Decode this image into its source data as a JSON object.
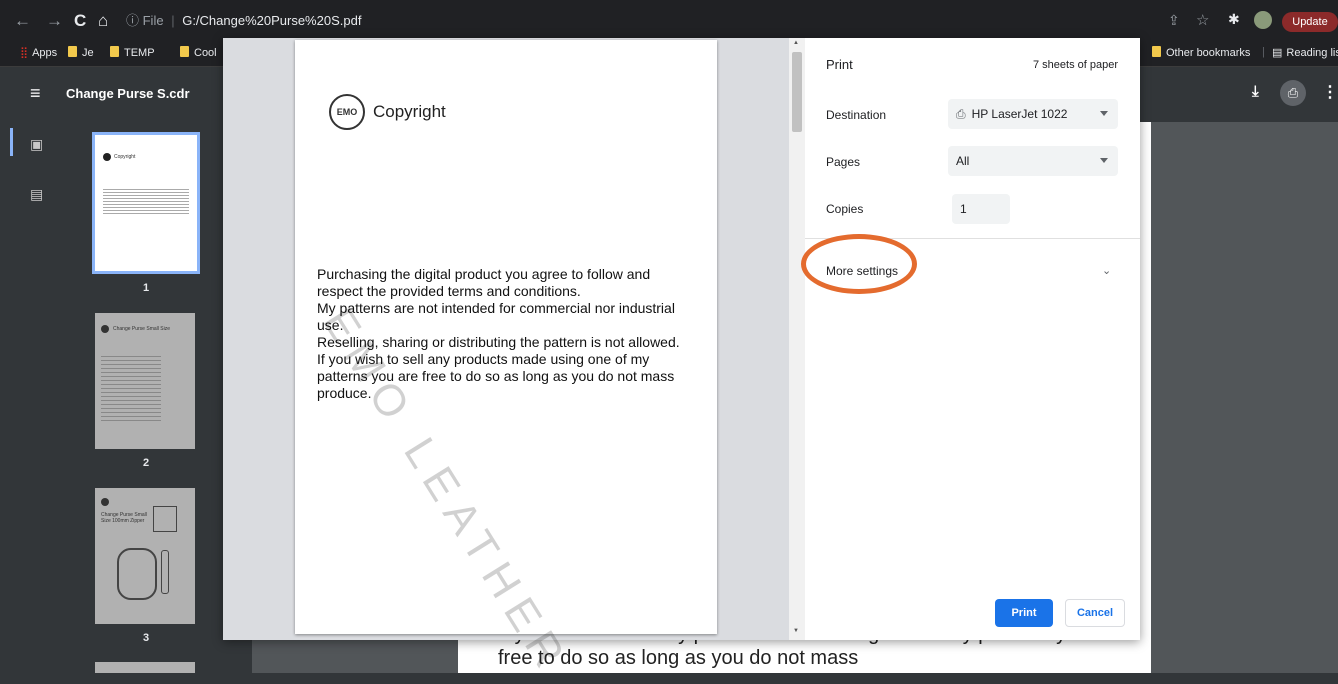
{
  "browser": {
    "url_prefix": "ⓘ File",
    "url": "G:/Change%20Purse%20S.pdf",
    "update_label": "Update",
    "bookmarks": [
      "Apps",
      "Je",
      "TEMP",
      "Cool"
    ],
    "bookmarks_right": [
      "Other bookmarks",
      "Reading lis"
    ]
  },
  "pdf": {
    "title": "Change Purse S.cdr",
    "thumbnails": [
      {
        "num": "1",
        "text": "Copyright"
      },
      {
        "num": "2",
        "text": "Change Purse Small Size"
      },
      {
        "num": "3",
        "text": "Change Purse Small Size 100mm Zipper"
      }
    ],
    "background_text": "If you wish to sell any products made using one of my patterns you are free to do so as long as you do not mass"
  },
  "preview": {
    "heading": "Copyright",
    "body": "Purchasing the digital product you agree to follow and respect the provided terms and conditions.\nMy patterns are not intended for commercial nor industrial use.\nReselling, sharing or distributing the pattern is not allowed.\nIf you wish to sell any products made using one of my patterns you are free to do so as long as you do not mass produce.",
    "watermark": "EMO LEATHER"
  },
  "print_dialog": {
    "title": "Print",
    "sheets": "7 sheets of paper",
    "destination_label": "Destination",
    "destination_value": "HP LaserJet 1022",
    "pages_label": "Pages",
    "pages_value": "All",
    "copies_label": "Copies",
    "copies_value": "1",
    "more_settings": "More settings",
    "print_label": "Print",
    "cancel_label": "Cancel"
  },
  "colors": {
    "accent": "#1a73e8",
    "highlight": "#e46b2e"
  }
}
